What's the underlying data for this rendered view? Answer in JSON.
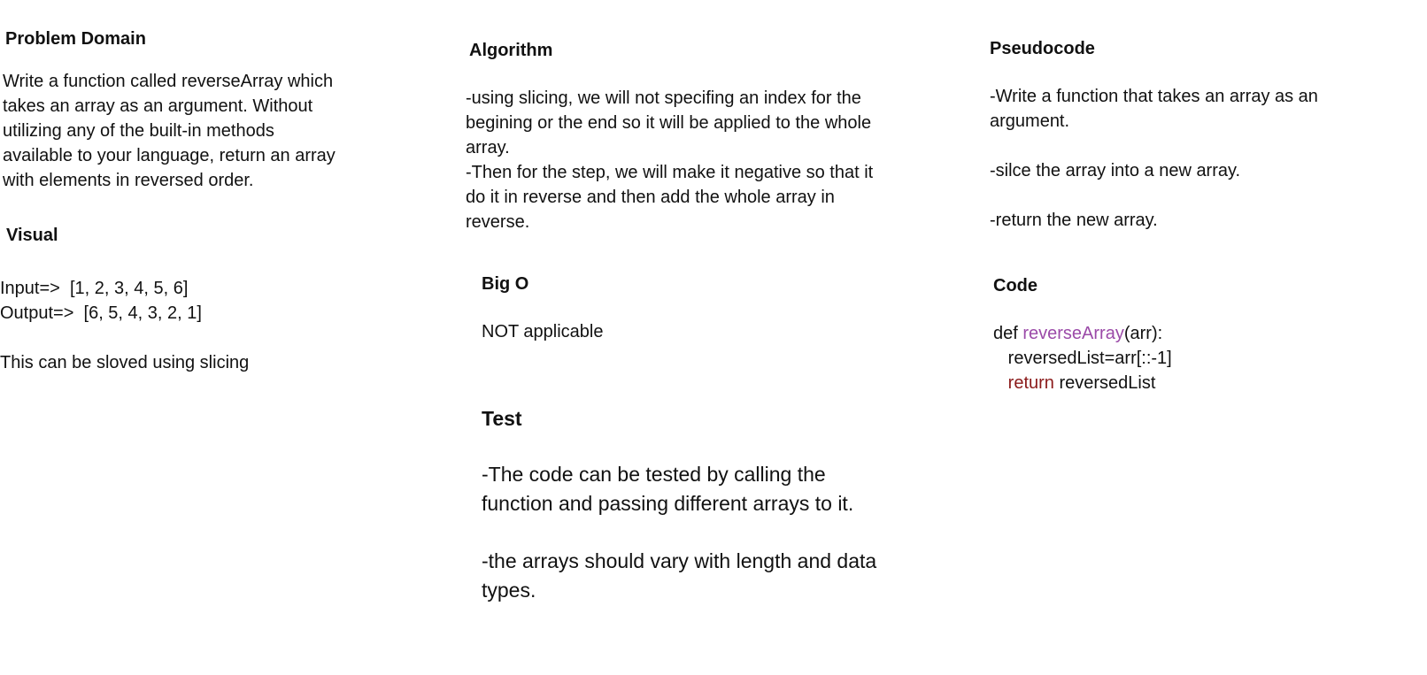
{
  "problem_domain": {
    "heading": "Problem Domain",
    "lines": [
      "Write a function called reverseArray which",
      "takes an array as an argument. Without",
      "utilizing any of the built-in methods",
      "available to your language, return an array",
      "with elements in reversed order."
    ]
  },
  "visual": {
    "heading": "Visual",
    "input": "Input=>  [1, 2, 3, 4, 5, 6]",
    "output": "Output=>  [6, 5, 4, 3, 2, 1]",
    "note": "This can be sloved using slicing"
  },
  "algorithm": {
    "heading": "Algorithm",
    "lines": [
      "-using slicing, we will not specifing an index for the",
      "begining or the end so it will be applied to the whole",
      "array.",
      "-Then for the step, we will make it negative so that it",
      "do it in reverse and then add the whole array in",
      "reverse."
    ]
  },
  "big_o": {
    "heading": "Big O",
    "text": "NOT applicable"
  },
  "test": {
    "heading": "Test",
    "para1": [
      "-The code can be tested by calling the",
      "function and passing different arrays to it."
    ],
    "para2": [
      "-the arrays should vary with length and data",
      "types."
    ]
  },
  "pseudocode": {
    "heading": "Pseudocode",
    "step1": [
      "-Write a function that takes an array as an",
      "argument."
    ],
    "step2": "-silce the array into a new array.",
    "step3": "-return the new array."
  },
  "code": {
    "heading": "Code",
    "line1_prefix": "def ",
    "line1_func": "reverseArray",
    "line1_suffix": "(arr):",
    "line2": "   reversedList=arr[::-1]",
    "line3_indent": "   ",
    "line3_keyword": "return",
    "line3_rest": " reversedList",
    "colors": {
      "function_name": "#9b4aa8",
      "return_keyword": "#8b1a1a"
    }
  }
}
